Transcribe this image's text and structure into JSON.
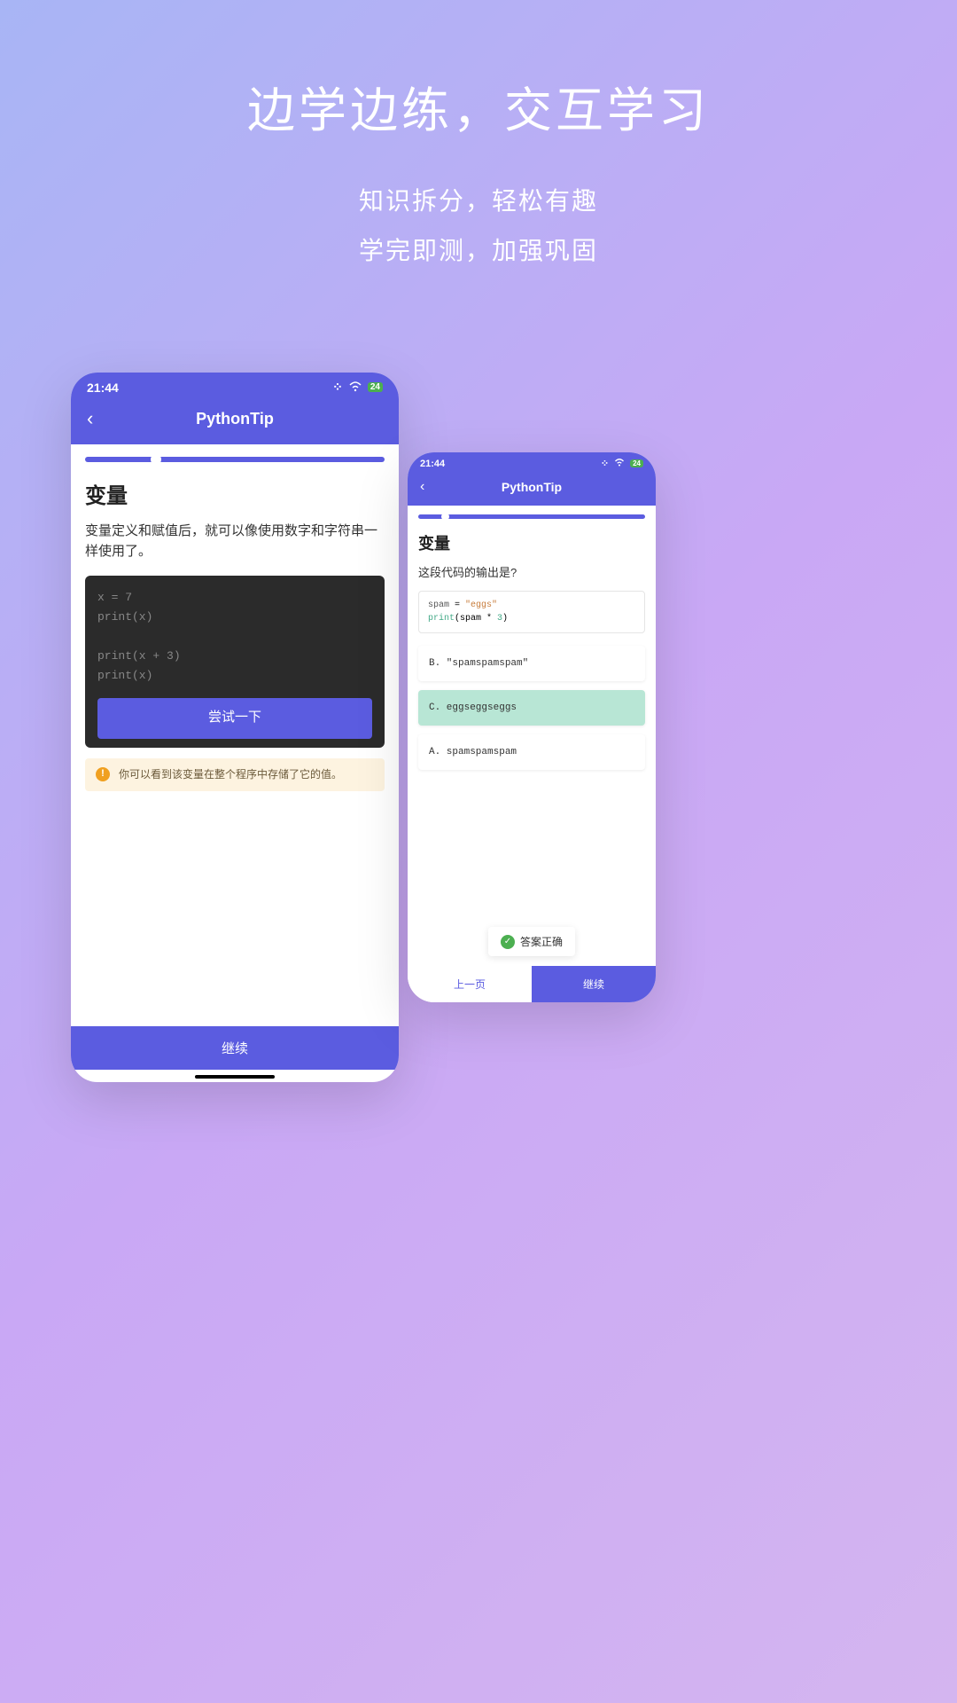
{
  "hero": {
    "title": "边学边练，交互学习",
    "sub1": "知识拆分，轻松有趣",
    "sub2": "学完即测，加强巩固"
  },
  "phone_left": {
    "status": {
      "time": "21:44",
      "battery": "24"
    },
    "nav": {
      "title": "PythonTip"
    },
    "progress_percent": 22,
    "section_title": "变量",
    "section_desc": "变量定义和赋值后，就可以像使用数字和字符串一样使用了。",
    "code_lines": [
      "x = 7",
      "print(x)",
      "",
      "print(x + 3)",
      "print(x)"
    ],
    "try_button": "尝试一下",
    "info_text": "你可以看到该变量在整个程序中存储了它的值。",
    "continue_button": "继续"
  },
  "phone_right": {
    "status": {
      "time": "21:44",
      "battery": "24"
    },
    "nav": {
      "title": "PythonTip"
    },
    "progress_percent": 10,
    "section_title": "变量",
    "question": "这段代码的输出是?",
    "code_lines": [
      "spam = \"eggs\"",
      "print(spam * 3)"
    ],
    "options": [
      {
        "label": "B. \"spamspamspam\"",
        "correct": false
      },
      {
        "label": "C. eggseggseggs",
        "correct": true
      },
      {
        "label": "A. spamspamspam",
        "correct": false
      }
    ],
    "answer_badge": "答案正确",
    "prev_button": "上一页",
    "continue_button": "继续"
  }
}
